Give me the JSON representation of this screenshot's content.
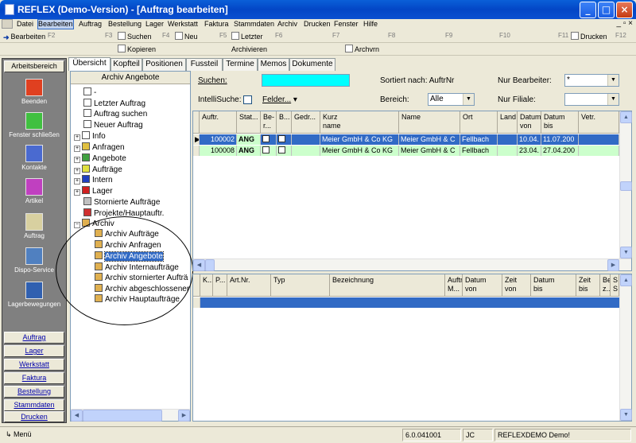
{
  "window": {
    "title": "REFLEX (Demo-Version) - [Auftrag bearbeiten]",
    "minimize": "_",
    "maximize": "□",
    "close": "×"
  },
  "mdi_controls": "_ ▫ ×",
  "menu": [
    "Datei",
    "Bearbeiten",
    "Auftrag",
    "Bestellung",
    "Lager",
    "Werkstatt",
    "Faktura",
    "Stammdaten",
    "Archiv",
    "Drucken",
    "Fenster",
    "Hilfe"
  ],
  "toolbar1": {
    "bearbeiten": "Bearbeiten",
    "suchen": "Suchen",
    "neu": "Neu",
    "letzter": "Letzter",
    "drucken": "Drucken",
    "fkeys": [
      "F2",
      "F3",
      "F4",
      "F5",
      "F6",
      "F7",
      "F8",
      "F9",
      "F10",
      "F11",
      "F12"
    ]
  },
  "toolbar2": {
    "kopieren": "Kopieren",
    "archivieren": "Archivieren",
    "archvrn": "Archvrn"
  },
  "leftnav": {
    "header": "Arbeitsbereich",
    "items": [
      "Beenden",
      "Fenster schließen",
      "Kontakte",
      "Artikel",
      "Auftrag",
      "Dispo-Service",
      "Lagerbewegungen"
    ],
    "lower": [
      "Auftrag",
      "Lager",
      "Werkstatt",
      "Faktura",
      "Bestellung",
      "Stammdaten",
      "Drucken"
    ]
  },
  "tabs": [
    "Übersicht",
    "Kopfteil",
    "Positionen",
    "Fussteil",
    "Termine",
    "Memos",
    "Dokumente"
  ],
  "tree": {
    "header": "Archiv Angebote",
    "nodes": [
      "-",
      "Letzter Auftrag",
      "Auftrag suchen",
      "Neuer Auftrag",
      "Info",
      "Anfragen",
      "Angebote",
      "Aufträge",
      "Intern",
      "Lager",
      "Stornierte Aufträge",
      "Projekte/Hauptauftr.",
      "Archiv",
      "Archiv Aufträge",
      "Archiv Anfragen",
      "Archiv Angebote",
      "Archiv Internaufträge",
      "Archiv stornierter Aufträ",
      "Archiv abgeschlossener",
      "Archiv Hauptaufträge"
    ]
  },
  "filters": {
    "suchen_label": "Suchen:",
    "sortiert": "Sortiert nach: AuftrNr",
    "nur_bearbeiter_label": "Nur Bearbeiter:",
    "nur_bearbeiter_value": "*",
    "intellisuche_label": "IntelliSuche:",
    "felder_label": "Felder...",
    "bereich_label": "Bereich:",
    "bereich_value": "Alle",
    "nur_filiale_label": "Nur Filiale:",
    "nur_filiale_value": ""
  },
  "grid1": {
    "headers": [
      "Auftr.",
      "Stat...",
      "Be-\nr...",
      "B...",
      "Gedr...",
      "Kurz\nname",
      "Name",
      "Ort",
      "Land",
      "Datum\nvon",
      "Datum\nbis",
      "Vetr."
    ],
    "rows": [
      {
        "auftr": "100002",
        "stat": "ANG",
        "kurz": "Meier GmbH & Co KG",
        "name": "Meier GmbH & C",
        "ort": "Fellbach",
        "land": "",
        "von": "10.04.",
        "bis": "11.07.200",
        "vetr": ""
      },
      {
        "auftr": "100008",
        "stat": "ANG",
        "kurz": "Meier GmbH & Co KG",
        "name": "Meier GmbH & C",
        "ort": "Fellbach",
        "land": "",
        "von": "23.04.",
        "bis": "27.04.200",
        "vetr": ""
      }
    ]
  },
  "grid2": {
    "headers": [
      "K...",
      "P...",
      "Art.Nr.",
      "Typ",
      "Bezeichnung",
      "Auftr\nM...",
      "Datum\nvon",
      "Zeit\nvon",
      "Datum\nbis",
      "Zeit\nbis",
      "Be\nz...",
      "S\nS"
    ]
  },
  "status": {
    "menu": "Menü",
    "version": "6.0.041001",
    "user": "JC",
    "db": "REFLEXDEMO Demo!"
  },
  "colors": {
    "selection": "#316ac5",
    "highlight_row": "#ccffcc",
    "search_field": "#00ffff",
    "nav_bg": "#808080"
  }
}
